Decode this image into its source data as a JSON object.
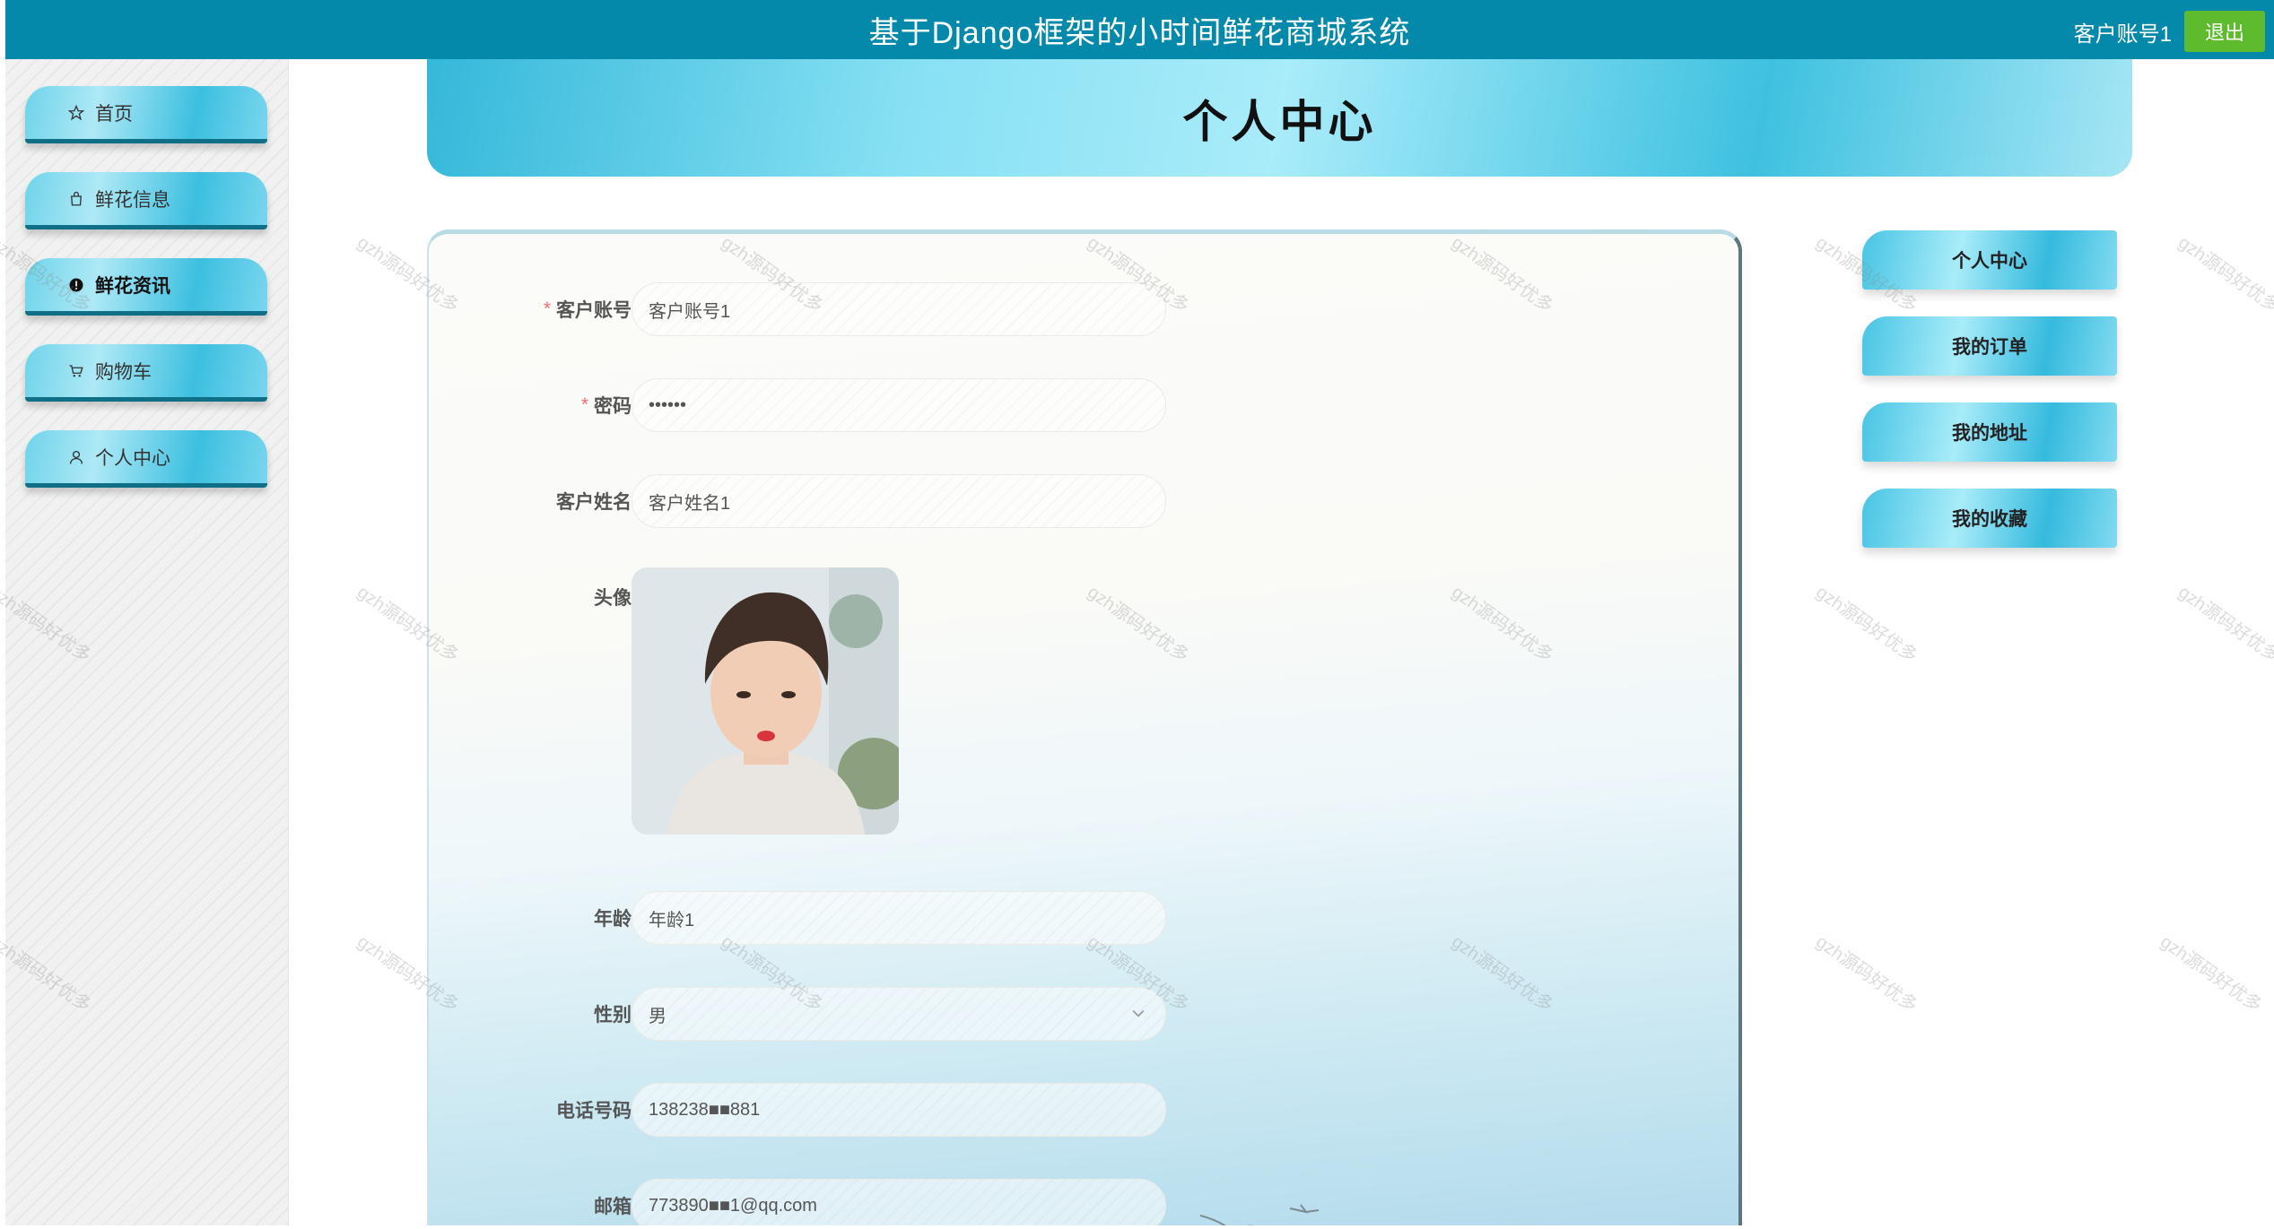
{
  "header": {
    "title": "基于Django框架的小时间鲜花商城系统",
    "user_label": "客户账号1",
    "logout_label": "退出"
  },
  "sidebar": {
    "items": [
      {
        "label": "首页",
        "icon": "star-icon"
      },
      {
        "label": "鲜花信息",
        "icon": "bag-icon"
      },
      {
        "label": "鲜花资讯",
        "icon": "info-icon",
        "active": true
      },
      {
        "label": "购物车",
        "icon": "cart-icon"
      },
      {
        "label": "个人中心",
        "icon": "user-icon"
      }
    ]
  },
  "banner": {
    "title": "个人中心"
  },
  "form": {
    "account": {
      "label": "客户账号",
      "value": "客户账号1",
      "required": true
    },
    "password": {
      "label": "密码",
      "value": "••••••",
      "required": true
    },
    "name": {
      "label": "客户姓名",
      "value": "客户姓名1"
    },
    "avatar": {
      "label": "头像"
    },
    "age": {
      "label": "年龄",
      "value": "年龄1"
    },
    "gender": {
      "label": "性别",
      "value": "男"
    },
    "phone": {
      "label": "电话号码",
      "value": "138238■■881"
    },
    "email": {
      "label": "邮箱",
      "value": "773890■■1@qq.com"
    }
  },
  "right_menu": {
    "items": [
      "个人中心",
      "我的订单",
      "我的地址",
      "我的收藏"
    ]
  },
  "watermark": "gzh源码好优多",
  "colors": {
    "topbar": "#0589aa",
    "logout": "#5fbb2e",
    "required": "#f56c6c",
    "accent": "#3ec1e0"
  }
}
